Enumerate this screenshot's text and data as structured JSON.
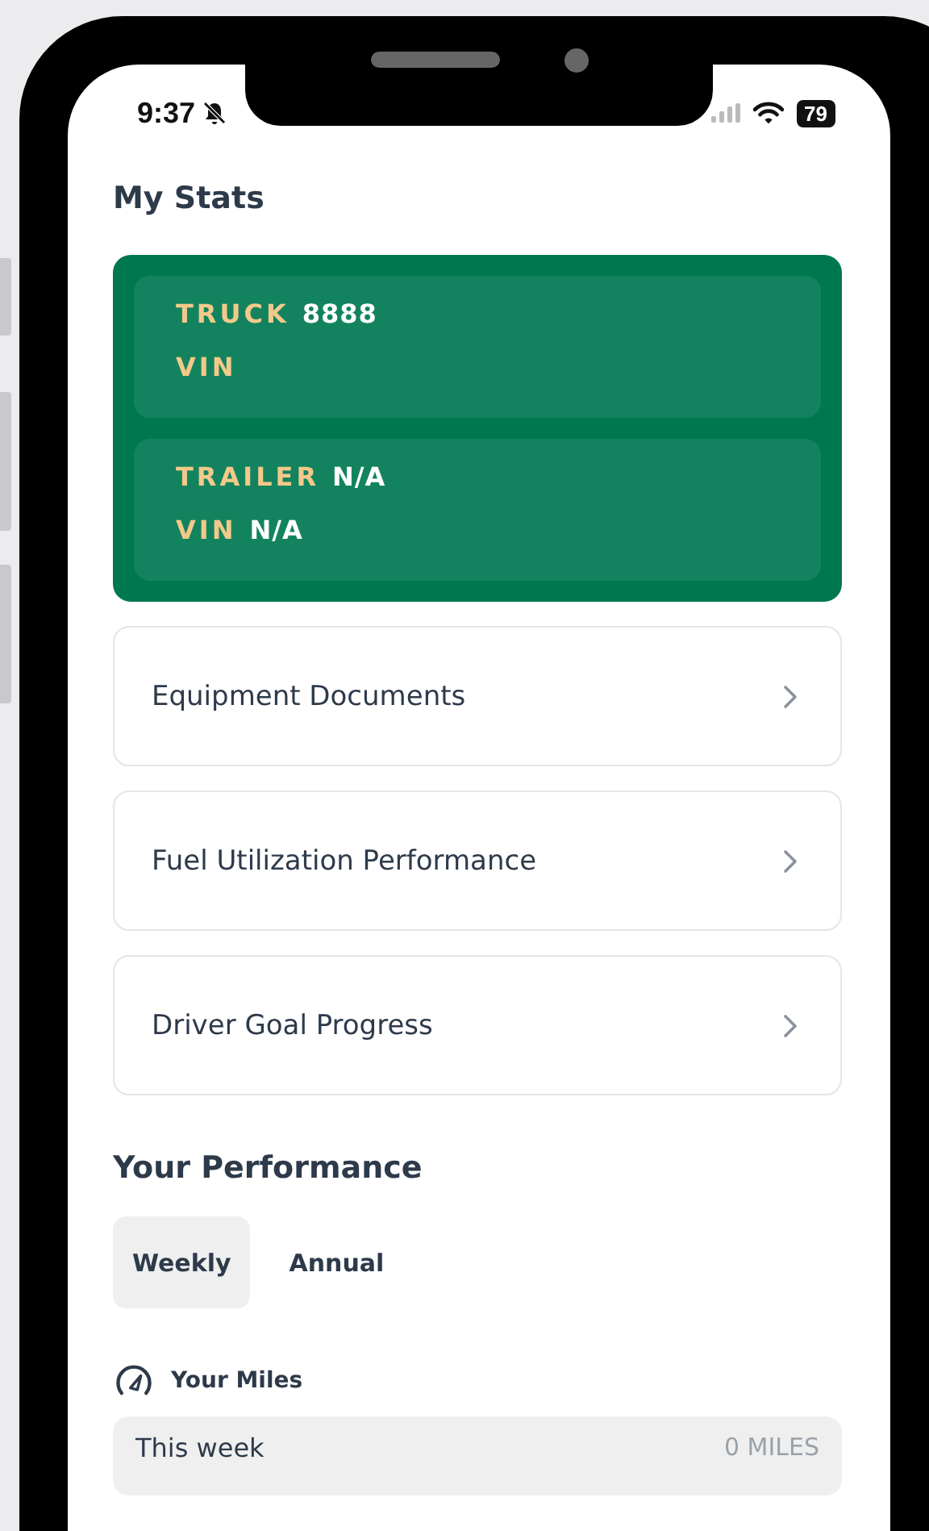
{
  "status_bar": {
    "time": "9:37",
    "battery": "79"
  },
  "stats": {
    "title": "My Stats",
    "vehicles": [
      {
        "lines": [
          {
            "label": "TRUCK",
            "value": "8888"
          },
          {
            "label": "VIN"
          }
        ]
      },
      {
        "lines": [
          {
            "label": "TRAILER",
            "value": "N/A"
          },
          {
            "label": "VIN",
            "value": "N/A"
          }
        ]
      }
    ]
  },
  "links": [
    {
      "label": "Equipment Documents"
    },
    {
      "label": "Fuel Utilization Performance"
    },
    {
      "label": "Driver Goal Progress"
    }
  ],
  "performance": {
    "title": "Your Performance",
    "tabs": [
      {
        "label": "Weekly",
        "selected": true
      },
      {
        "label": "Annual",
        "selected": false
      }
    ],
    "miles": {
      "title": "Your Miles",
      "rows": [
        {
          "label": "This week",
          "value": "0 MILES"
        }
      ]
    }
  }
}
